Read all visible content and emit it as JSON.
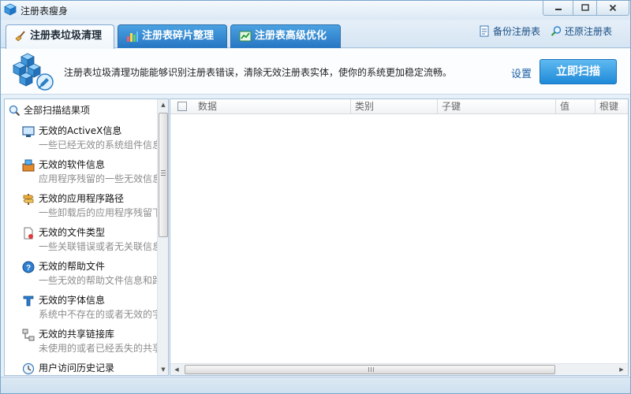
{
  "window": {
    "title": "注册表瘦身",
    "minimize_icon": "minimize-icon",
    "maximize_icon": "maximize-icon",
    "close_icon": "close-icon"
  },
  "tabs": [
    {
      "label": "注册表垃圾清理",
      "icon": "broom-icon",
      "active": true
    },
    {
      "label": "注册表碎片整理",
      "icon": "defrag-blocks-icon",
      "active": false
    },
    {
      "label": "注册表高级优化",
      "icon": "chart-icon",
      "active": false
    }
  ],
  "links": {
    "backup": "备份注册表",
    "restore": "还原注册表"
  },
  "info": {
    "description": "注册表垃圾清理功能能够识别注册表错误，清除无效注册表实体，使你的系统更加稳定流畅。",
    "settings": "设置",
    "scan_button": "立即扫描"
  },
  "tree": {
    "root_label": "全部扫描结果项",
    "items": [
      {
        "title": "无效的ActiveX信息",
        "desc": "一些已经无效的系统组件信息",
        "icon": "activex-icon"
      },
      {
        "title": "无效的软件信息",
        "desc": "应用程序残留的一些无效信息",
        "icon": "software-box-icon"
      },
      {
        "title": "无效的应用程序路径",
        "desc": "一些卸载后的应用程序残留下",
        "icon": "signpost-icon"
      },
      {
        "title": "无效的文件类型",
        "desc": "一些关联错误或者无关联信息",
        "icon": "file-type-icon"
      },
      {
        "title": "无效的帮助文件",
        "desc": "一些无效的帮助文件信息和路",
        "icon": "help-icon"
      },
      {
        "title": "无效的字体信息",
        "desc": "系统中不存在的或者无效的字",
        "icon": "font-icon"
      },
      {
        "title": "无效的共享链接库",
        "desc": "未使用的或者已经丢失的共享",
        "icon": "shared-library-icon"
      },
      {
        "title": "用户访问历史记录",
        "desc": "",
        "icon": "history-clock-icon"
      }
    ]
  },
  "grid": {
    "columns": [
      "数据",
      "类别",
      "子键",
      "值",
      "根键"
    ]
  },
  "colors": {
    "tab_active_bg": "#f4f9fd",
    "tab_inactive_bg": "#2f86d2",
    "scan_button_bg": "#2b95dd",
    "link_color": "#1a5fa6"
  }
}
